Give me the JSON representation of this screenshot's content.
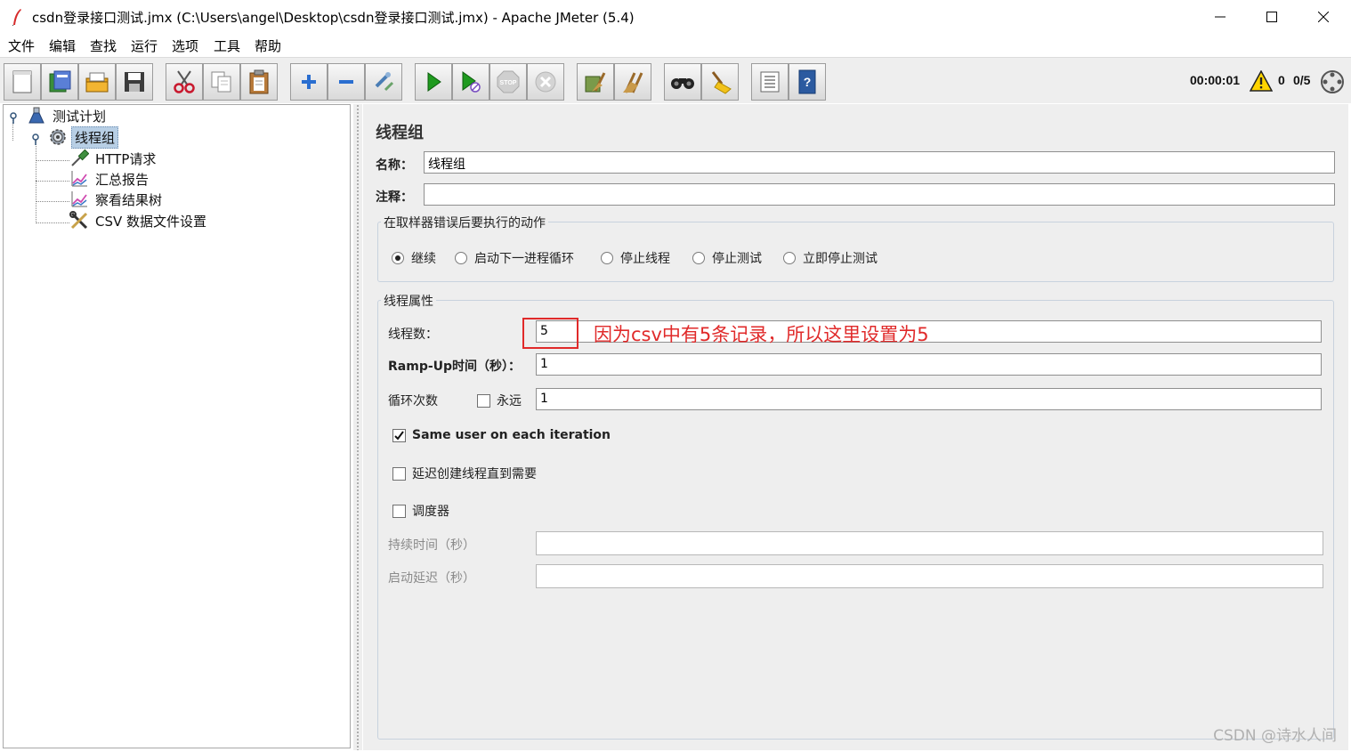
{
  "window": {
    "title": "csdn登录接口测试.jmx (C:\\Users\\angel\\Desktop\\csdn登录接口测试.jmx) - Apache JMeter (5.4)"
  },
  "menu": [
    "文件",
    "编辑",
    "查找",
    "运行",
    "选项",
    "工具",
    "帮助"
  ],
  "toolbar": {
    "buttons": [
      "new-icon",
      "templates-icon",
      "open-icon",
      "save-icon",
      "cut-icon",
      "copy-icon",
      "paste-icon",
      "expand-icon",
      "collapse-icon",
      "toggle-icon",
      "start-icon",
      "start-no-pause-icon",
      "stop-icon",
      "shutdown-icon",
      "clear-icon",
      "clear-all-icon",
      "search-icon",
      "reset-search-icon",
      "function-helper-icon",
      "help-icon"
    ],
    "elapsed": "00:00:01",
    "warnings": "0",
    "threads": "0/5"
  },
  "tree": {
    "root": "测试计划",
    "thread_group": "线程组",
    "children": [
      "HTTP请求",
      "汇总报告",
      "察看结果树",
      "CSV 数据文件设置"
    ]
  },
  "panel": {
    "heading": "线程组",
    "name_label": "名称：",
    "name_value": "线程组",
    "comment_label": "注释：",
    "comment_value": "",
    "error_action": {
      "title": "在取样器错误后要执行的动作",
      "options": [
        "继续",
        "启动下一进程循环",
        "停止线程",
        "停止测试",
        "立即停止测试"
      ],
      "selected": "继续"
    },
    "thread_props": {
      "title": "线程属性",
      "threads_label": "线程数：",
      "threads_value": "5",
      "rampup_label": "Ramp-Up时间（秒）：",
      "rampup_value": "1",
      "loop_label": "循环次数",
      "forever_label": "永远",
      "forever_checked": false,
      "loop_value": "1",
      "same_user_label": "Same user on each iteration",
      "same_user_checked": true,
      "delay_label": "延迟创建线程直到需要",
      "delay_checked": false,
      "scheduler_label": "调度器",
      "scheduler_checked": false,
      "duration_label": "持续时间（秒）",
      "duration_value": "",
      "startup_delay_label": "启动延迟（秒）",
      "startup_delay_value": ""
    }
  },
  "annotation": "因为csv中有5条记录，所以这里设置为5",
  "watermark": "CSDN @诗水人间",
  "colors": {
    "annotation": "#e02a2a",
    "selection": "#b8cfe5",
    "panel_bg": "#eeeeee"
  }
}
